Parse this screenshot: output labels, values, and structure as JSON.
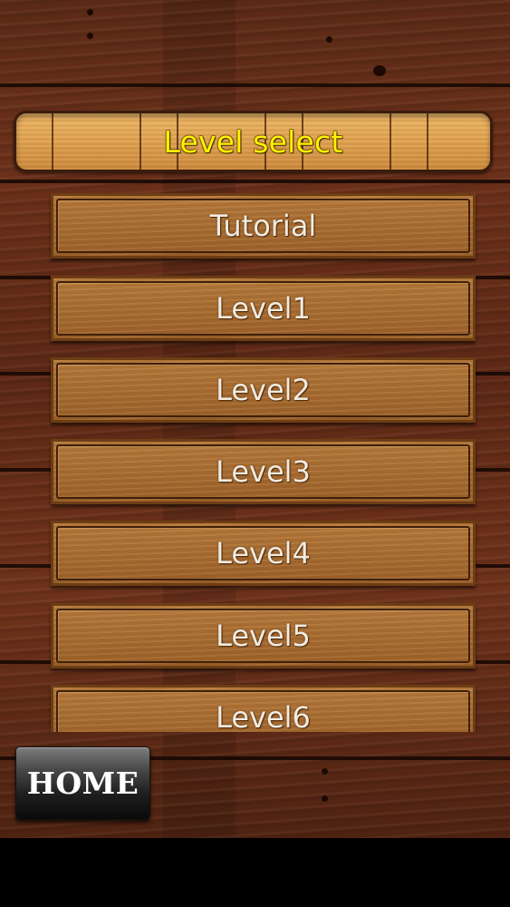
{
  "title": "Level select",
  "levels": [
    {
      "label": "Tutorial"
    },
    {
      "label": "Level1"
    },
    {
      "label": "Level2"
    },
    {
      "label": "Level3"
    },
    {
      "label": "Level4"
    },
    {
      "label": "Level5"
    },
    {
      "label": "Level6"
    }
  ],
  "home_button": {
    "label": "HOME"
  },
  "colors": {
    "title_text": "#fff200",
    "wood_background": "#5c2815",
    "button_wood": "#a86d32",
    "home_button": "#1e1e1e"
  }
}
